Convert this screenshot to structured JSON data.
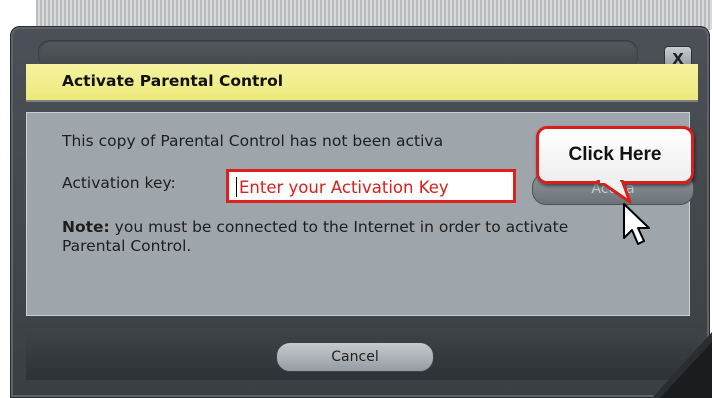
{
  "window": {
    "close_label": "X"
  },
  "header": {
    "title": "Activate Parental Control"
  },
  "content": {
    "status_text": "This copy of Parental Control has not been activa",
    "activation_key_label": "Activation key:",
    "activation_key_hint": "Enter your Activation Key",
    "activate_label": "Activa",
    "note_bold": "Note:",
    "note_text": " you must be connected to the Internet in order to activate Parental Control."
  },
  "callout": {
    "text": "Click Here"
  },
  "footer": {
    "cancel_label": "Cancel"
  },
  "colors": {
    "header_yellow": "#ecea7c",
    "highlight_red": "#d8201a",
    "panel_gray": "#9fa6ab",
    "frame_dark": "#3a3f43"
  },
  "icons": {
    "close": "close-icon",
    "cursor": "mouse-pointer-icon"
  }
}
